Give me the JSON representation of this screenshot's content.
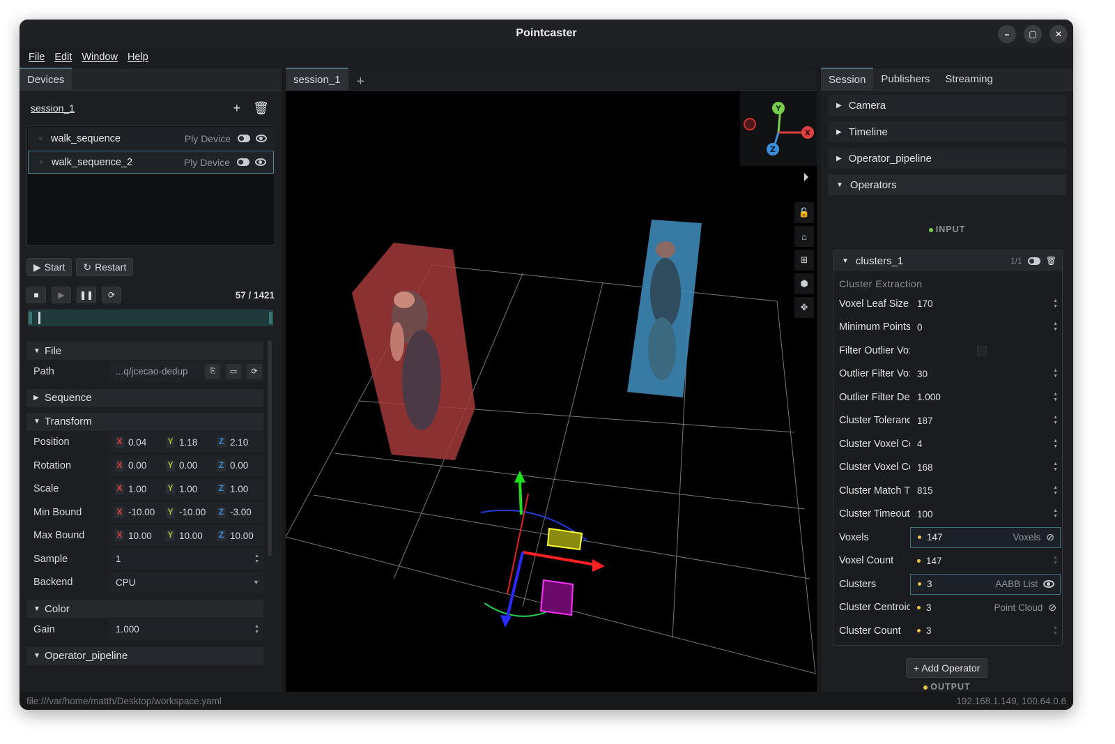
{
  "window": {
    "title": "Pointcaster",
    "controls": [
      "–",
      "▢",
      "✕"
    ]
  },
  "menu": [
    "File",
    "Edit",
    "Window",
    "Help"
  ],
  "left": {
    "tab": "Devices",
    "session_name": "session_1",
    "devices": [
      {
        "name": "walk_sequence",
        "type": "Ply Device"
      },
      {
        "name": "walk_sequence_2",
        "type": "Ply Device"
      }
    ],
    "start_label": "Start",
    "restart_label": "Restart",
    "frame_counter": "57 / 1421",
    "playback_fraction": 0.04,
    "sections": {
      "file": "File",
      "sequence": "Sequence",
      "transform": "Transform",
      "color": "Color",
      "operator_pipeline": "Operator_pipeline"
    },
    "path_label": "Path",
    "path_value": "...q/jcecao-dedup",
    "transform": [
      {
        "label": "Position",
        "x": "0.04",
        "y": "1.18",
        "z": "2.10"
      },
      {
        "label": "Rotation",
        "x": "0.00",
        "y": "0.00",
        "z": "0.00"
      },
      {
        "label": "Scale",
        "x": "1.00",
        "y": "1.00",
        "z": "1.00"
      },
      {
        "label": "Min Bound",
        "x": "-10.00",
        "y": "-10.00",
        "z": "-3.00"
      },
      {
        "label": "Max Bound",
        "x": "10.00",
        "y": "10.00",
        "z": "10.00"
      }
    ],
    "sample_label": "Sample",
    "sample_value": "1",
    "backend_label": "Backend",
    "backend_value": "CPU",
    "gain_label": "Gain",
    "gain_value": "1.000",
    "axis_x": "X",
    "axis_y": "Y",
    "axis_z": "Z"
  },
  "viewport": {
    "tab": "session_1",
    "gizmo_x": "X",
    "gizmo_y": "Y",
    "gizmo_z": "Z"
  },
  "right": {
    "tabs": [
      "Session",
      "Publishers",
      "Streaming"
    ],
    "sections": [
      "Camera",
      "Timeline",
      "Operator_pipeline"
    ],
    "operators_label": "Operators",
    "input_label": "INPUT",
    "output_label": "OUTPUT",
    "operator": {
      "name": "clusters_1",
      "count": "1/1",
      "subtitle": "Cluster Extraction",
      "params": [
        {
          "label": "Voxel Leaf Size",
          "value": "170"
        },
        {
          "label": "Minimum Points",
          "value": "0"
        },
        {
          "label": "Filter Outlier Vo:",
          "value": ""
        },
        {
          "label": "Outlier Filter Vo:",
          "value": "30"
        },
        {
          "label": "Outlier Filter De",
          "value": "1.000"
        },
        {
          "label": "Cluster Toleranc",
          "value": "187"
        },
        {
          "label": "Cluster Voxel Co",
          "value": "4"
        },
        {
          "label": "Cluster Voxel Co",
          "value": "168"
        },
        {
          "label": "Cluster Match Ti",
          "value": "815"
        },
        {
          "label": "Cluster Timeout",
          "value": "100"
        }
      ],
      "outputs": [
        {
          "label": "Voxels",
          "value": "147",
          "type": "Voxels",
          "boxed": true,
          "eye": "hidden"
        },
        {
          "label": "Voxel Count",
          "value": "147",
          "type": "",
          "boxed": false,
          "eye": ""
        },
        {
          "label": "Clusters",
          "value": "3",
          "type": "AABB List",
          "boxed": true,
          "eye": "shown"
        },
        {
          "label": "Cluster Centroic",
          "value": "3",
          "type": "Point Cloud",
          "boxed": false,
          "eye": "hidden"
        },
        {
          "label": "Cluster Count",
          "value": "3",
          "type": "",
          "boxed": false,
          "eye": ""
        }
      ]
    },
    "add_operator_label": "+ Add Operator"
  },
  "status": {
    "left": "file:///var/home/matth/Desktop/workspace.yaml",
    "right": "192.168.1.149, 100.64.0.6"
  }
}
